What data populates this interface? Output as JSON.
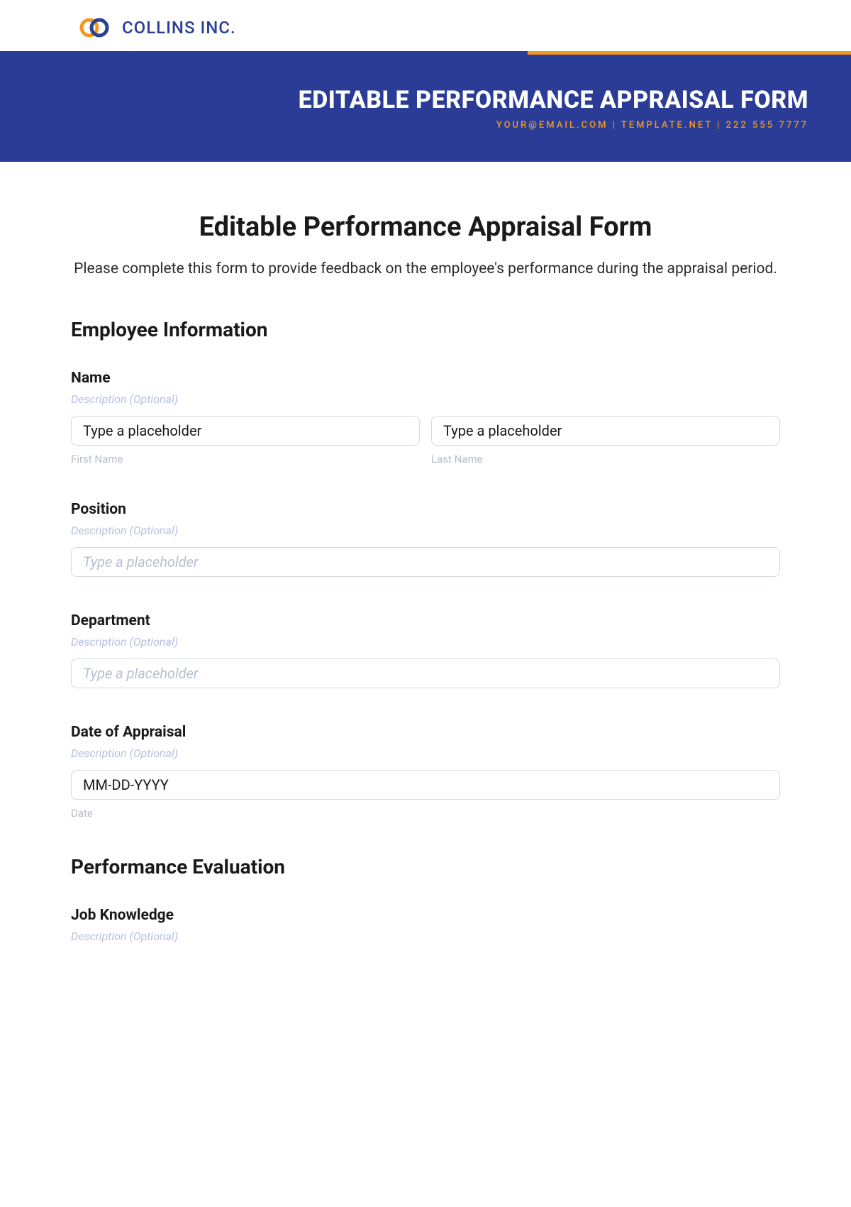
{
  "header": {
    "company_name": "COLLINS INC."
  },
  "banner": {
    "title": "EDITABLE PERFORMANCE APPRAISAL FORM",
    "subtitle": "YOUR@EMAIL.COM | TEMPLATE.NET | 222 555 7777"
  },
  "form": {
    "title": "Editable Performance Appraisal Form",
    "intro": "Please complete this form to provide feedback on the employee's performance during the appraisal period.",
    "section1_heading": "Employee Information",
    "name": {
      "label": "Name",
      "desc": "Description (Optional)",
      "first_placeholder": "Type a placeholder",
      "first_sublabel": "First Name",
      "last_placeholder": "Type a placeholder",
      "last_sublabel": "Last Name"
    },
    "position": {
      "label": "Position",
      "desc": "Description (Optional)",
      "placeholder": "Type a placeholder"
    },
    "department": {
      "label": "Department",
      "desc": "Description (Optional)",
      "placeholder": "Type a placeholder"
    },
    "date": {
      "label": "Date of Appraisal",
      "desc": "Description (Optional)",
      "placeholder": "MM-DD-YYYY",
      "sublabel": "Date"
    },
    "section2_heading": "Performance Evaluation",
    "job_knowledge": {
      "label": "Job Knowledge",
      "desc": "Description (Optional)"
    }
  }
}
